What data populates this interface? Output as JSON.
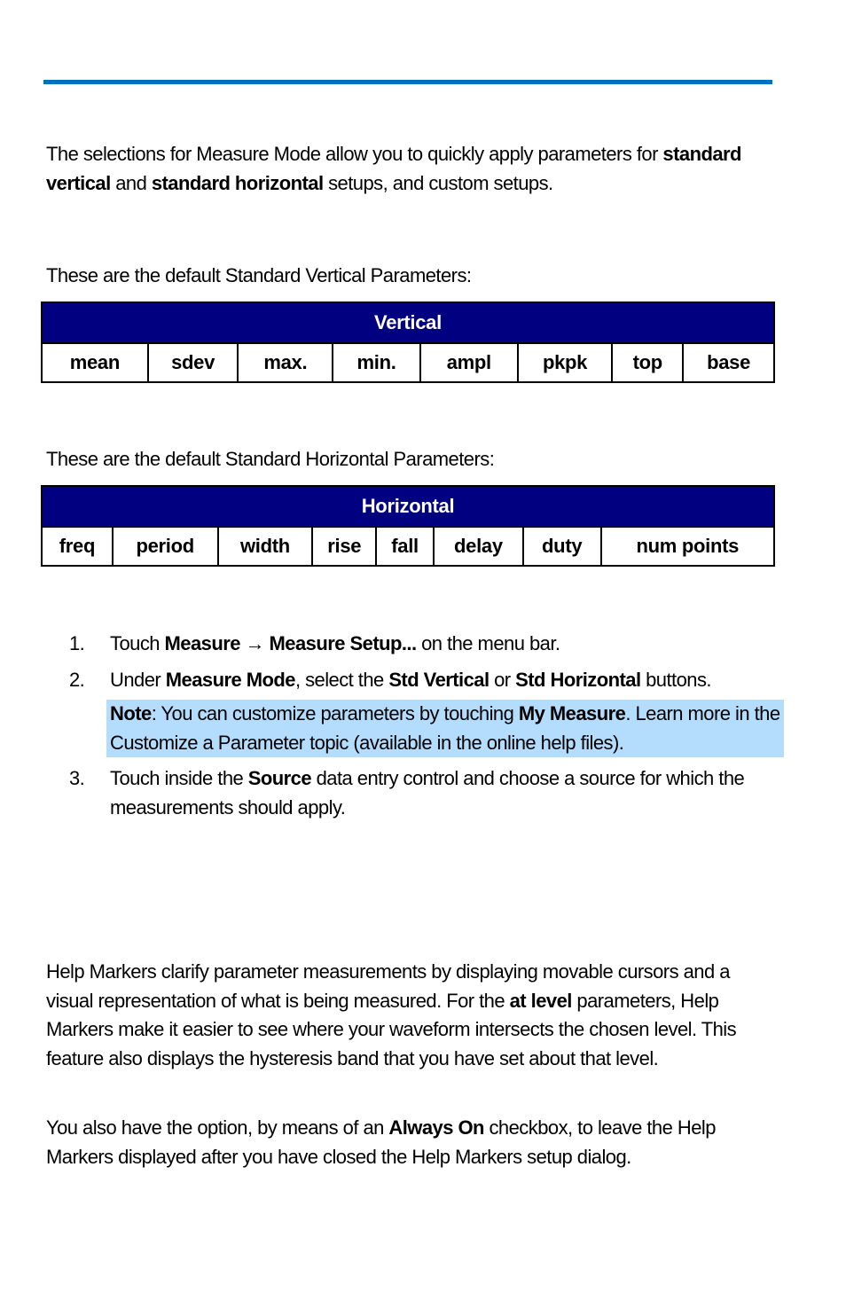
{
  "intro": {
    "text_a": "The selections for Measure Mode allow you to quickly apply parameters for ",
    "bold_a": "standard vertical",
    "text_b": " and ",
    "bold_b": "standard horizontal",
    "text_c": " setups, and custom setups."
  },
  "vertical_section": {
    "caption": "These are the default Standard Vertical Parameters:",
    "header": "Vertical",
    "params": [
      "mean",
      "sdev",
      "max.",
      "min.",
      "ampl",
      "pkpk",
      "top",
      "base"
    ]
  },
  "horizontal_section": {
    "caption": "These are the default Standard Horizontal Parameters:",
    "header": "Horizontal",
    "params": [
      "freq",
      "period",
      "width",
      "rise",
      "fall",
      "delay",
      "duty",
      "num points"
    ]
  },
  "steps": [
    {
      "num": "1.",
      "t1": "Touch ",
      "b1": "Measure → Measure Setup...",
      "t2": " on the menu bar."
    },
    {
      "num": "2.",
      "t1": "Under ",
      "b1": "Measure Mode",
      "t2": ", select the ",
      "b2": "Std Vertical",
      "t3": " or ",
      "b3": "Std Horizontal",
      "t4": " buttons.",
      "note": {
        "label": "Note",
        "t1": ": You can customize parameters by touching ",
        "b1": "My Measure",
        "t2": ". Learn more in the Customize a Parameter topic (available in the online help files)."
      }
    },
    {
      "num": "3.",
      "t1": "Touch inside the ",
      "b1": "Source",
      "t2": " data entry control and choose a source for which the measurements should apply."
    }
  ],
  "help_markers": {
    "p1_a": "Help Markers clarify parameter measurements by displaying movable cursors and a visual representation of what is being measured. For the ",
    "p1_bold": "at level",
    "p1_b": " parameters, Help Markers make it easier to see where your waveform intersects the chosen level. This feature also displays the hysteresis band that you have set about that level.",
    "p2_a": "You also have the option, by means of an ",
    "p2_bold": "Always On",
    "p2_b": " checkbox, to leave the Help Markers displayed after you have closed the Help Markers setup dialog."
  }
}
